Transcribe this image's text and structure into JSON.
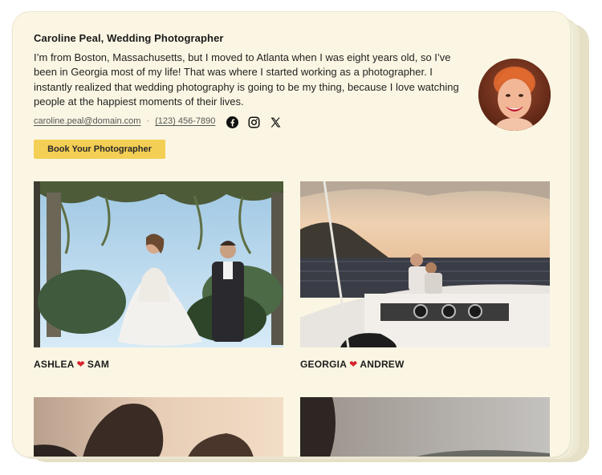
{
  "profile": {
    "name": "Caroline Peal, Wedding Photographer",
    "bio": "I’m from Boston, Massachusetts, but I moved to Atlanta when I was eight years old, so I’ve been in Georgia most of my life! That was where I started working as a photographer. I instantly realized that wedding photography is going to be my thing, because I love watching people at the happiest moments of their lives.",
    "email": "caroline.peal@domain.com",
    "separator": "·",
    "phone": "(123) 456-7890",
    "cta_label": "Book Your Photographer"
  },
  "socials": [
    "facebook-icon",
    "instagram-icon",
    "x-icon"
  ],
  "gallery": [
    {
      "couple_a": "ASHLEA",
      "heart": "❤",
      "couple_b": "SAM"
    },
    {
      "couple_a": "GEORGIA",
      "heart": "❤",
      "couple_b": "ANDREW"
    }
  ],
  "colors": {
    "card_bg": "#fbf6e3",
    "cta_bg": "#f4cf55",
    "heart": "#d8232a"
  }
}
